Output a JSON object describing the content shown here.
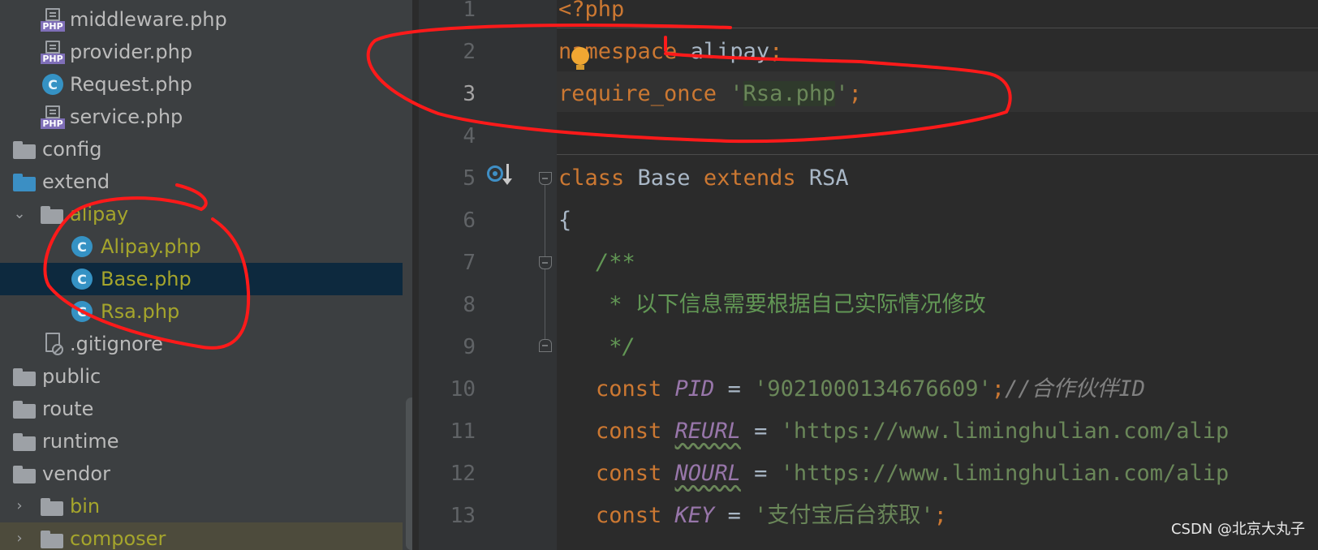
{
  "project_tree": {
    "items": [
      {
        "name": "middleware.php",
        "icon": "php-file-icon"
      },
      {
        "name": "provider.php",
        "icon": "php-file-icon"
      },
      {
        "name": "Request.php",
        "icon": "class-icon"
      },
      {
        "name": "service.php",
        "icon": "php-file-icon"
      },
      {
        "name": "config",
        "icon": "folder-icon"
      },
      {
        "name": "extend",
        "icon": "folder-icon"
      },
      {
        "name": "alipay",
        "icon": "folder-icon",
        "expanded": true
      },
      {
        "name": "Alipay.php",
        "icon": "class-icon"
      },
      {
        "name": "Base.php",
        "icon": "class-icon",
        "selected": true
      },
      {
        "name": "Rsa.php",
        "icon": "class-icon"
      },
      {
        "name": ".gitignore",
        "icon": "ignored-file-icon"
      },
      {
        "name": "public",
        "icon": "folder-icon"
      },
      {
        "name": "route",
        "icon": "folder-icon"
      },
      {
        "name": "runtime",
        "icon": "folder-icon"
      },
      {
        "name": "vendor",
        "icon": "folder-icon"
      },
      {
        "name": "bin",
        "icon": "folder-icon",
        "expanded": false
      },
      {
        "name": "composer",
        "icon": "folder-icon",
        "expanded": false
      }
    ],
    "class_icon_letter": "C",
    "php_tag": "PHP"
  },
  "editor": {
    "line_numbers": [
      "1",
      "2",
      "3",
      "4",
      "5",
      "6",
      "7",
      "8",
      "9",
      "10",
      "11",
      "12",
      "13"
    ],
    "current_line": "3",
    "code": {
      "l1": {
        "open_tag": "<?php"
      },
      "l2": {
        "kw": "namespace",
        "name": " alipay",
        "semi": ";"
      },
      "l3": {
        "kw": "require_once",
        "sp": " ",
        "q1": "'",
        "file": "Rsa.php",
        "q2": "'",
        "semi": ";"
      },
      "l5": {
        "kw1": "class",
        "name": " Base ",
        "kw2": "extends",
        "parent": " RSA"
      },
      "l6": {
        "brace": "{"
      },
      "l7": {
        "comment": "/**"
      },
      "l8": {
        "comment": " * 以下信息需要根据自己实际情况修改"
      },
      "l9": {
        "comment": " */"
      },
      "l10": {
        "kw": "const ",
        "name": "PID",
        "eq": " = ",
        "value": "'9021000134676609'",
        "semi": ";",
        "comment": "//合作伙伴ID"
      },
      "l11": {
        "kw": "const ",
        "name": "REURL",
        "eq": " = ",
        "value": "'https://www.liminghulian.com/alip"
      },
      "l12": {
        "kw": "const ",
        "name": "NOURL",
        "eq": " = ",
        "value": "'https://www.liminghulian.com/alip"
      },
      "l13": {
        "kw": "const ",
        "name": "KEY",
        "eq": " = ",
        "value": "'支付宝后台获取'",
        "semi": ";"
      }
    }
  },
  "watermark": "CSDN @北京大丸子",
  "colors": {
    "tree_bg": "#3c3f41",
    "selected_bg": "#0d293e",
    "editor_bg": "#2b2b2b",
    "keyword": "#cc7832",
    "string": "#6a8759",
    "constant": "#9876aa",
    "annotation": "#ff1a1a"
  }
}
